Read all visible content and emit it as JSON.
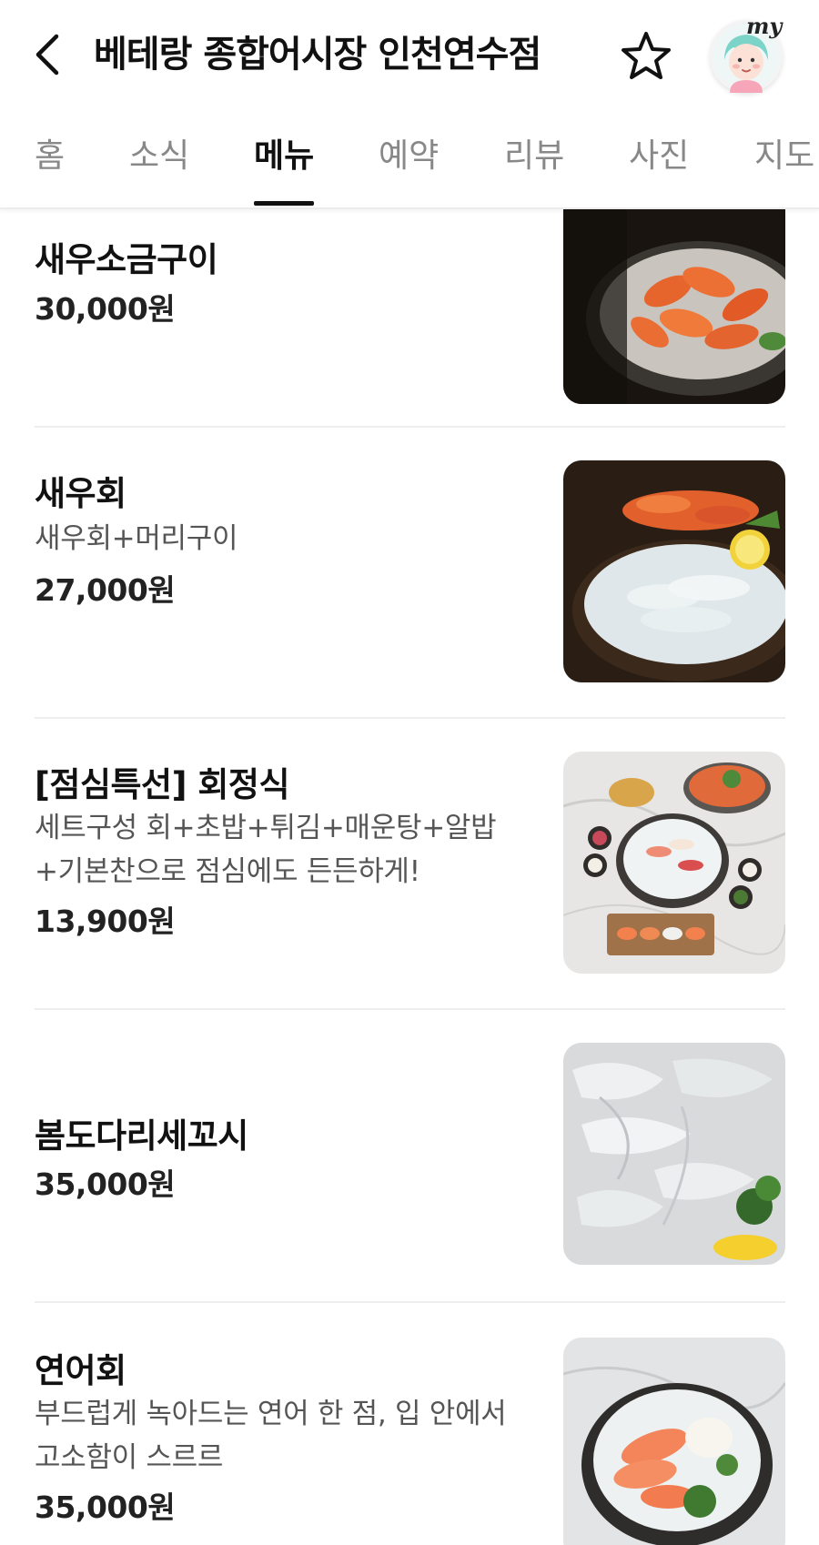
{
  "header": {
    "title": "베테랑 종합어시장 인천연수점",
    "avatar_label": "my",
    "icons": {
      "back": "back-chevron-icon",
      "favorite": "star-outline-icon"
    }
  },
  "tabs": [
    {
      "label": "홈",
      "active": false
    },
    {
      "label": "소식",
      "active": false
    },
    {
      "label": "메뉴",
      "active": true
    },
    {
      "label": "예약",
      "active": false
    },
    {
      "label": "리뷰",
      "active": false
    },
    {
      "label": "사진",
      "active": false
    },
    {
      "label": "지도",
      "active": false
    }
  ],
  "menu": [
    {
      "name": "새우소금구이",
      "price": "30,000원"
    },
    {
      "name": "새우회",
      "desc": "새우회+머리구이",
      "price": "27,000원"
    },
    {
      "name": "[점심특선] 회정식",
      "desc_lines": [
        "세트구성 회+초밥+튀김+매운탕+알밥",
        "+기본찬으로 점심에도 든든하게!"
      ],
      "price": "13,900원"
    },
    {
      "name": "봄도다리세꼬시",
      "price": "35,000원"
    },
    {
      "name": "연어회",
      "desc_lines": [
        "부드럽게 녹아드는 연어 한 점, 입 안에서",
        "고소함이 스르르"
      ],
      "price": "35,000원"
    }
  ],
  "colors": {
    "active_tab": "#111111",
    "inactive_tab": "#888888",
    "divider": "#eeeeee"
  }
}
